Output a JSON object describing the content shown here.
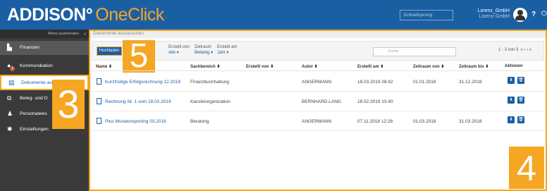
{
  "header": {
    "brand_main": "ADDISON°",
    "brand_sub": "OneClick",
    "jump_placeholder": "Schnellsprung",
    "user_company": "Lorenz_GmbH",
    "user_sub": "Lorenz GmbH",
    "help": "?",
    "power": "⏻"
  },
  "sidebar": {
    "hide_label": "Menü ausblenden",
    "hide_chevron": "‹",
    "items": [
      {
        "label": "Finanzen",
        "icon": "chart-icon",
        "glyph": "▙"
      },
      {
        "label": "Kommunikation",
        "icon": "chat-icon",
        "glyph": "●",
        "badge": "1"
      },
      {
        "label": "Dokumente austauschen",
        "icon": "document-icon",
        "glyph": "▤"
      },
      {
        "label": "Beleg- und D",
        "icon": "receipt-icon",
        "glyph": "⧉"
      },
      {
        "label": "Personalwes",
        "icon": "people-icon",
        "glyph": "♟"
      },
      {
        "label": "Einstellungen",
        "icon": "gear-icon",
        "glyph": "✱"
      }
    ],
    "callout": "3"
  },
  "main": {
    "breadcrumb": "Dokumente austauschen",
    "upload_label": "Hochladen",
    "callout_toolbar": "5",
    "callout_table": "4",
    "filters": [
      {
        "label": "Erstellt von",
        "value": "Alle ▾"
      },
      {
        "label": "Zeitraum",
        "value": "Beliebig ▾"
      },
      {
        "label": "Erstellt am",
        "value": "Jahr ▾"
      }
    ],
    "search_placeholder": "Suche",
    "pager_text": "1 - 3 von 3",
    "pager_arrows": "« ‹ › »",
    "columns": [
      "Name ⬍",
      "Sachbereich ⬍",
      "Erstellt von ⬍",
      "Autor ⬍",
      "Erstellt am ⬍",
      "Zeitraum von ⬍",
      "Zeitraum bis ⬍",
      "Aktionen"
    ],
    "rows": [
      {
        "name": "Kurzfristige Erfolgsrechnung 12.2018",
        "sachbereich": "Finanzbuchhaltung",
        "erstellt_von": "",
        "autor": "ANGERMANN",
        "erstellt_am": "18.03.2019 08:42",
        "von": "01.01.2018",
        "bis": "31.12.2018"
      },
      {
        "name": "Rechnung Nr. 1 vom 18.02.2019",
        "sachbereich": "Kanzleiorganisation",
        "erstellt_von": "",
        "autor": "BERNHARD.LANG",
        "erstellt_am": "18.02.2019 15:40",
        "von": "",
        "bis": ""
      },
      {
        "name": "Plus Monatsreporting 03.2018",
        "sachbereich": "Beratung",
        "erstellt_von": "",
        "autor": "ANGERMANN",
        "erstellt_am": "07.11.2018 12:28",
        "von": "01.03.2018",
        "bis": "31.03.2018"
      }
    ],
    "action_download": "⬇",
    "action_delete": "🗑"
  },
  "colors": {
    "brand": "#1b5fa3",
    "accent": "#f5a623",
    "sidebar": "#3a3a3a"
  }
}
